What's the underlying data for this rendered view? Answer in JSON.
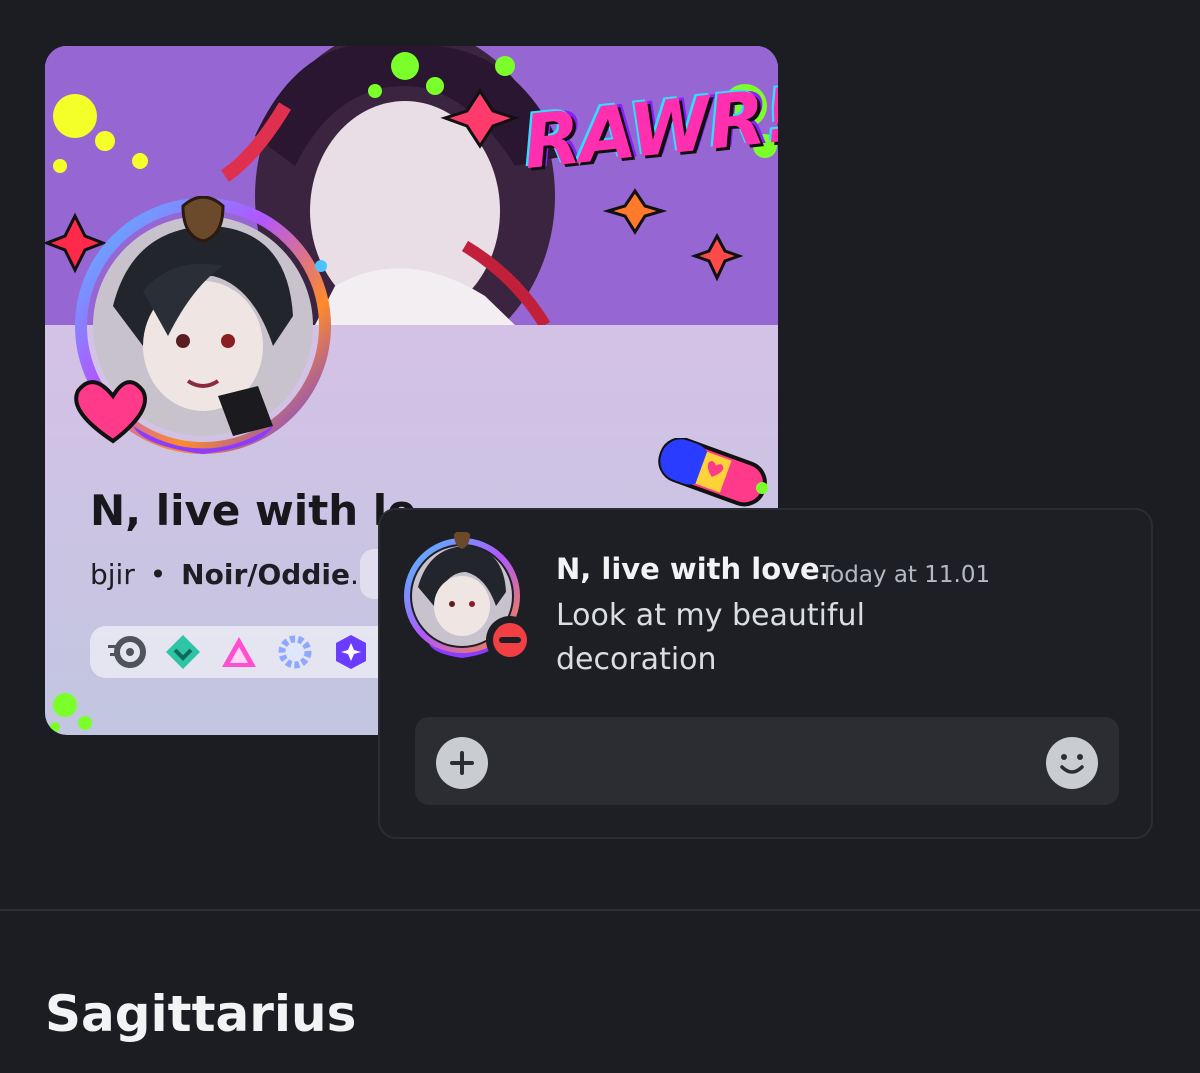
{
  "profile": {
    "banner_text": "RAWR!",
    "display_name": "N, live with lo",
    "username": "bjir",
    "separator": "•",
    "pronouns": "Noir/Oddie",
    "pronouns_suffix": ".",
    "badges": [
      {
        "icon": "nitro-badge-icon"
      },
      {
        "icon": "boost-badge-icon"
      },
      {
        "icon": "hypesquad-badge-icon"
      },
      {
        "icon": "laurel-badge-icon"
      },
      {
        "icon": "quest-badge-icon"
      }
    ]
  },
  "preview": {
    "author": "N, live with love.",
    "timestamp": "Today at 11.01",
    "message_line1": "Look at my beautiful",
    "message_line2": "decoration",
    "status": "do-not-disturb",
    "status_color": "#f23f43"
  },
  "section": {
    "title": "Sagittarius"
  }
}
